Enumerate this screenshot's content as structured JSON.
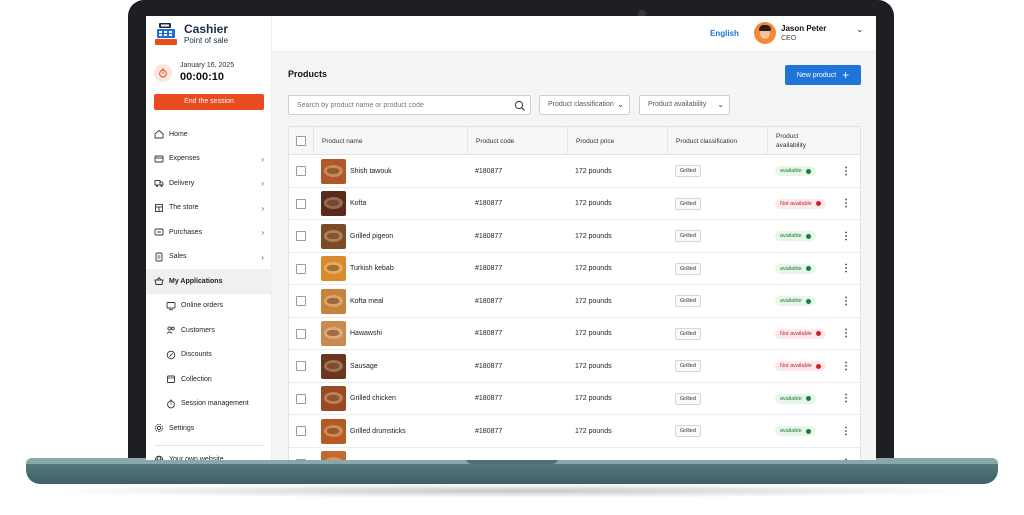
{
  "brand": {
    "title": "Cashier",
    "subtitle": "Point of sale"
  },
  "session": {
    "date": "January 16, 2025",
    "timer": "00:00:10",
    "end_label": "End the session"
  },
  "sidebar": {
    "items": [
      {
        "label": "Home",
        "icon": "home-icon",
        "chevron": false
      },
      {
        "label": "Expenses",
        "icon": "expenses-icon",
        "chevron": true
      },
      {
        "label": "Delivery",
        "icon": "delivery-truck-icon",
        "chevron": true
      },
      {
        "label": "The store",
        "icon": "store-icon",
        "chevron": true
      },
      {
        "label": "Purchases",
        "icon": "purchases-icon",
        "chevron": true
      },
      {
        "label": "Sales",
        "icon": "sales-icon",
        "chevron": true
      },
      {
        "label": "My Applications",
        "icon": "applications-basket-icon",
        "chevron": false,
        "active": true
      },
      {
        "label": "Online orders",
        "icon": "online-orders-icon",
        "sub": true
      },
      {
        "label": "Customers",
        "icon": "customers-icon",
        "sub": true
      },
      {
        "label": "Discounts",
        "icon": "discounts-icon",
        "sub": true
      },
      {
        "label": "Collection",
        "icon": "collection-icon",
        "sub": true
      },
      {
        "label": "Session management",
        "icon": "session-timer-icon",
        "sub": true
      },
      {
        "label": "Settings",
        "icon": "settings-gear-icon",
        "chevron": false
      }
    ],
    "footer_label": "Your own website"
  },
  "header": {
    "language": "English",
    "user_name": "Jason Peter",
    "user_role": "CEO"
  },
  "main": {
    "title": "Products",
    "new_button": "New product",
    "search_placeholder": "Search by product name or product code",
    "filters": [
      "Product classification",
      "Product availability"
    ]
  },
  "table": {
    "columns": [
      "Product name",
      "Product code",
      "Product price",
      "Product classification",
      "Product availability"
    ],
    "rows": [
      {
        "name": "Shish tawouk",
        "code": "#180877",
        "price": "172 pounds",
        "classification": "Grilled",
        "availability": "available",
        "available": true,
        "thumb_color": "#b0582a"
      },
      {
        "name": "Kofta",
        "code": "#180877",
        "price": "172 pounds",
        "classification": "Grilled",
        "availability": "Not available",
        "available": false,
        "thumb_color": "#5b2a1c"
      },
      {
        "name": "Grilled pigeon",
        "code": "#180877",
        "price": "172 pounds",
        "classification": "Grilled",
        "availability": "available",
        "available": true,
        "thumb_color": "#7c4a26"
      },
      {
        "name": "Turkish kebab",
        "code": "#180877",
        "price": "172 pounds",
        "classification": "Grilled",
        "availability": "available",
        "available": true,
        "thumb_color": "#d98a2e"
      },
      {
        "name": "Kofta meal",
        "code": "#180877",
        "price": "172 pounds",
        "classification": "Grilled",
        "availability": "available",
        "available": true,
        "thumb_color": "#c5833c"
      },
      {
        "name": "Hawawshi",
        "code": "#180877",
        "price": "172 pounds",
        "classification": "Grilled",
        "availability": "Not available",
        "available": false,
        "thumb_color": "#c98a52"
      },
      {
        "name": "Sausage",
        "code": "#180877",
        "price": "172 pounds",
        "classification": "Grilled",
        "availability": "Not available",
        "available": false,
        "thumb_color": "#6b3520"
      },
      {
        "name": "Grilled chicken",
        "code": "#180877",
        "price": "172 pounds",
        "classification": "Grilled",
        "availability": "available",
        "available": true,
        "thumb_color": "#9a4a22"
      },
      {
        "name": "Grilled drumsticks",
        "code": "#180877",
        "price": "172 pounds",
        "classification": "Grilled",
        "availability": "available",
        "available": true,
        "thumb_color": "#b55a24"
      },
      {
        "name": "",
        "code": "",
        "price": "",
        "classification": "",
        "availability": "",
        "available": true,
        "thumb_color": "#c06a30"
      }
    ]
  },
  "colors": {
    "accent": "#1f74d8",
    "danger": "#ea4b1f",
    "available": "#16803a",
    "unavailable": "#d62020",
    "laptop_base": "#4d6f76"
  }
}
